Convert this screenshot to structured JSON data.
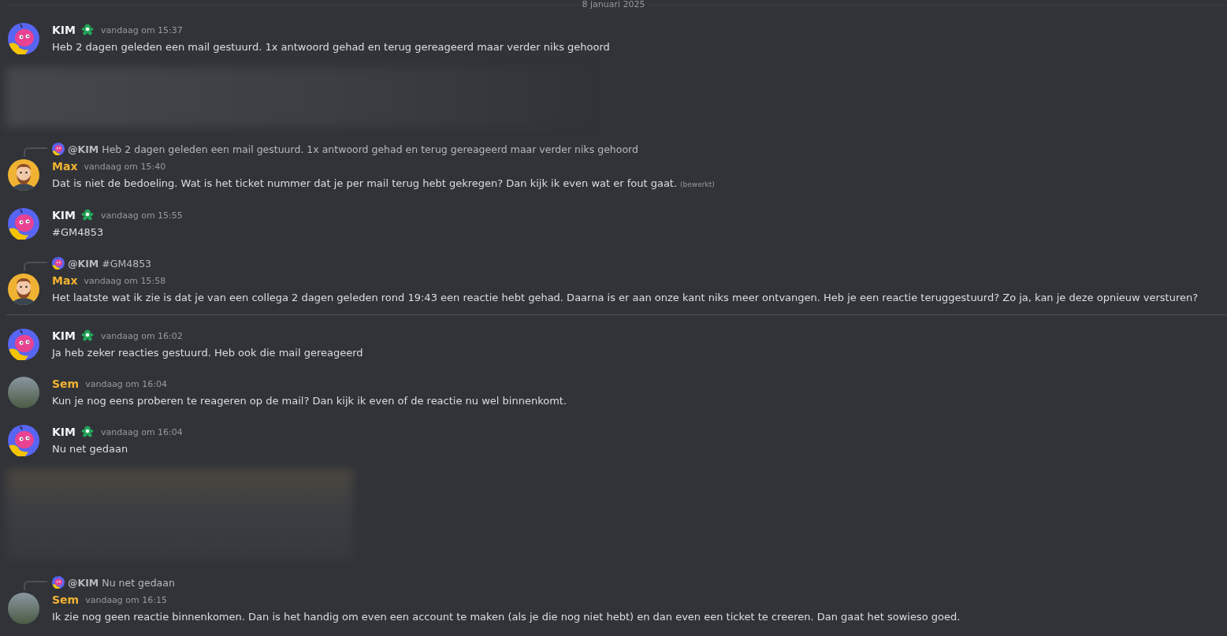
{
  "date_divider": "8 januari 2025",
  "items": [
    {
      "kind": "message",
      "avatar": {
        "kind": "kim"
      },
      "author": "KIM",
      "color": "#f2f3f5",
      "badge": true,
      "time": "vandaag om 15:37",
      "text": "Heb 2 dagen geleden een mail gestuurd. 1x antwoord gehad en terug gereageerd maar verder niks gehoord"
    },
    {
      "kind": "blurstrip"
    },
    {
      "kind": "message",
      "avatar": {
        "kind": "max"
      },
      "reply": {
        "avatar": {
          "kind": "kim"
        },
        "author": "@KIM",
        "text": "Heb 2 dagen geleden een mail gestuurd. 1x antwoord gehad en terug gereageerd maar verder niks gehoord"
      },
      "author": "Max",
      "color": "#f0b232",
      "badge": false,
      "time": "vandaag om 15:40",
      "text": "Dat is niet de bedoeling. Wat is het ticket nummer dat je per mail terug hebt gekregen? Dan kijk ik even wat er fout gaat.",
      "edited_label": "(bewerkt)"
    },
    {
      "kind": "message",
      "avatar": {
        "kind": "kim"
      },
      "author": "KIM",
      "color": "#f2f3f5",
      "badge": true,
      "time": "vandaag om 15:55",
      "text": "#GM4853"
    },
    {
      "kind": "message",
      "avatar": {
        "kind": "max"
      },
      "reply": {
        "avatar": {
          "kind": "kim"
        },
        "author": "@KIM",
        "text": "#GM4853"
      },
      "author": "Max",
      "color": "#f0b232",
      "badge": false,
      "time": "vandaag om 15:58",
      "text": "Het laatste wat ik zie is dat je van een collega 2 dagen geleden rond 19:43 een reactie hebt gehad. Daarna is er aan onze kant niks meer ontvangen. Heb je een reactie teruggestuurd? Zo ja, kan je deze opnieuw versturen?"
    },
    {
      "kind": "divider"
    },
    {
      "kind": "message",
      "avatar": {
        "kind": "kim"
      },
      "author": "KIM",
      "color": "#f2f3f5",
      "badge": true,
      "time": "vandaag om 16:02",
      "text": "Ja heb zeker reacties gestuurd. Heb ook die mail gereageerd"
    },
    {
      "kind": "message",
      "avatar": {
        "kind": "sem"
      },
      "author": "Sem",
      "color": "#f0b232",
      "badge": false,
      "time": "vandaag om 16:04",
      "text": "Kun je nog eens proberen te reageren op de mail? Dan kijk ik even of de reactie nu wel binnenkomt."
    },
    {
      "kind": "message",
      "avatar": {
        "kind": "kim"
      },
      "author": "KIM",
      "color": "#f2f3f5",
      "badge": true,
      "time": "vandaag om 16:04",
      "text": "Nu net gedaan"
    },
    {
      "kind": "blurblock"
    },
    {
      "kind": "message",
      "avatar": {
        "kind": "sem"
      },
      "reply": {
        "avatar": {
          "kind": "kim"
        },
        "author": "@KIM",
        "text": "Nu net gedaan"
      },
      "author": "Sem",
      "color": "#f0b232",
      "badge": false,
      "time": "vandaag om 16:15",
      "text": "Ik zie nog geen reactie binnenkomen. Dan is het handig om even een account te maken (als je die nog niet hebt) en dan even een ticket te creeren. Dan gaat het sowieso goed."
    }
  ]
}
